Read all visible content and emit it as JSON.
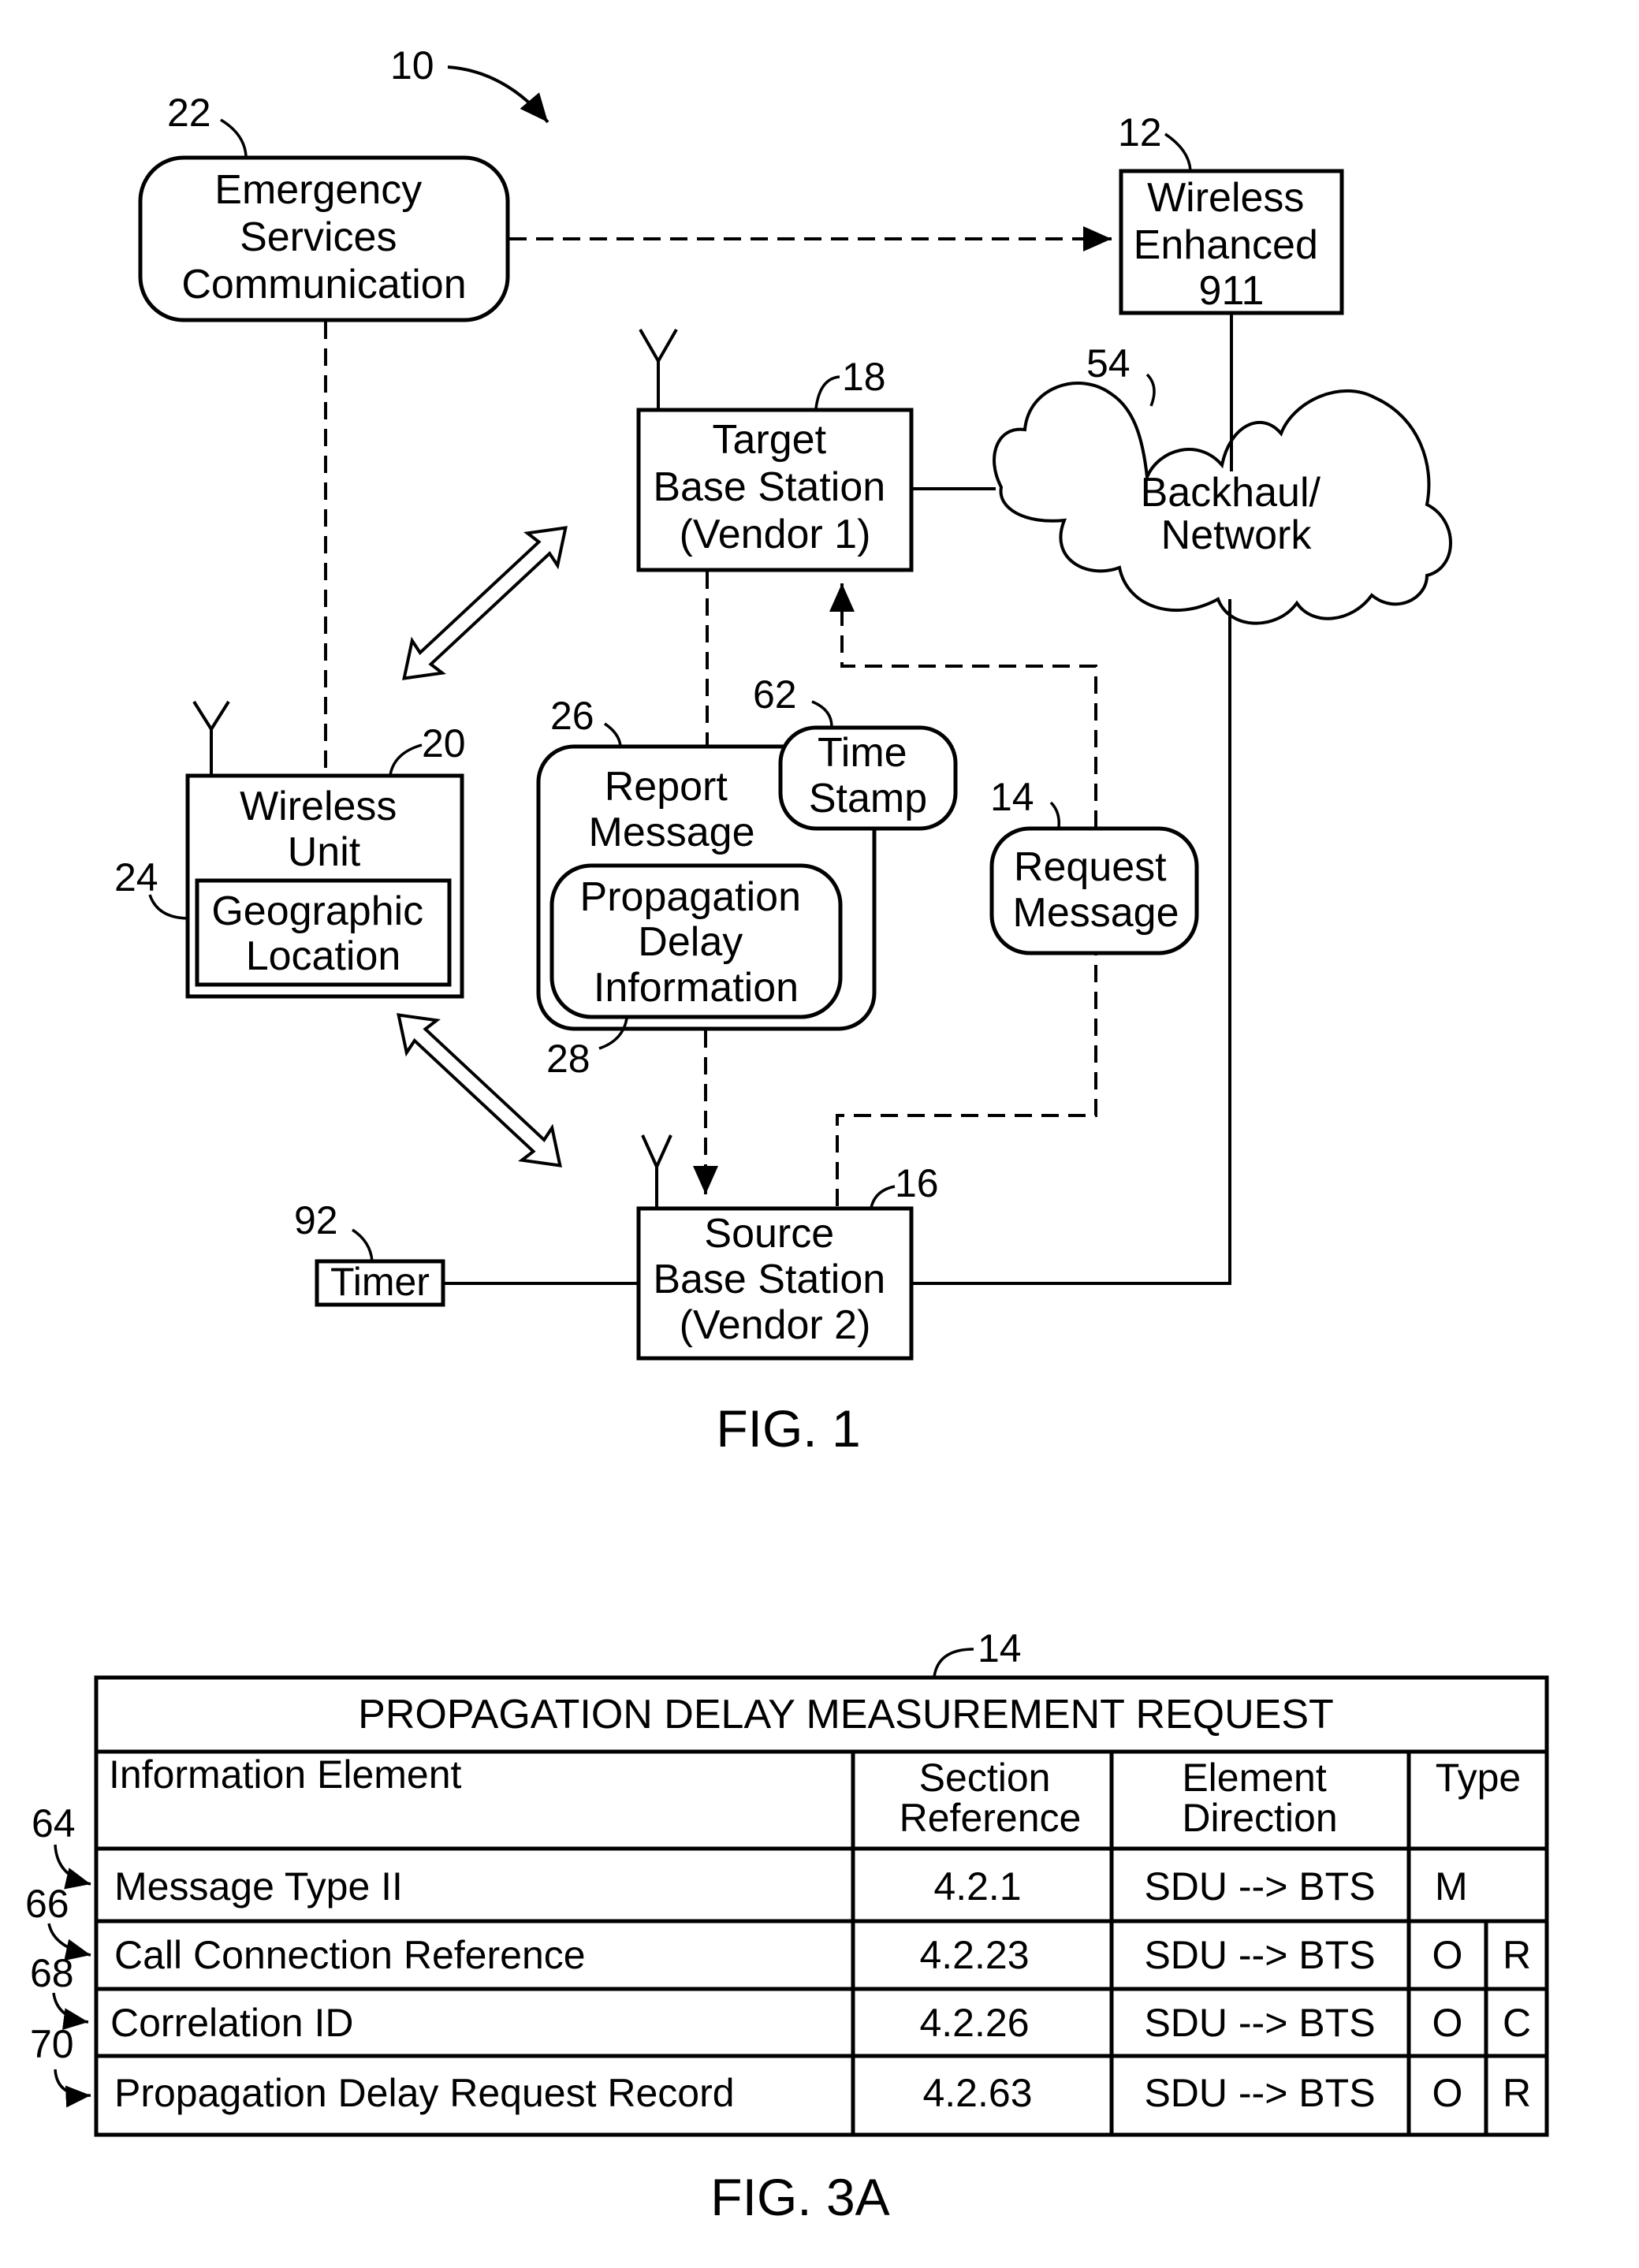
{
  "figure1": {
    "caption": "FIG. 1",
    "system_ref": "10",
    "nodes": {
      "emergency": {
        "ref": "22",
        "lines": [
          "Emergency",
          "Services",
          "Communication"
        ]
      },
      "e911": {
        "ref": "12",
        "lines": [
          "Wireless",
          "Enhanced",
          "911"
        ]
      },
      "target_bs": {
        "ref": "18",
        "lines": [
          "Target",
          "Base Station",
          "(Vendor 1)"
        ]
      },
      "network": {
        "ref": "54",
        "lines": [
          "Backhaul/",
          "Network"
        ]
      },
      "wireless_unit": {
        "ref": "20",
        "lines": [
          "Wireless",
          "Unit"
        ]
      },
      "geo_location": {
        "ref": "24",
        "lines": [
          "Geographic",
          "Location"
        ]
      },
      "report_message": {
        "ref": "26",
        "lines": [
          "Report",
          "Message"
        ]
      },
      "time_stamp": {
        "ref": "62",
        "lines": [
          "Time",
          "Stamp"
        ]
      },
      "prop_delay_info": {
        "ref": "28",
        "lines": [
          "Propagation",
          "Delay",
          "Information"
        ]
      },
      "request_message": {
        "ref": "14",
        "lines": [
          "Request",
          "Message"
        ]
      },
      "source_bs": {
        "ref": "16",
        "lines": [
          "Source",
          "Base Station",
          "(Vendor 2)"
        ]
      },
      "timer": {
        "ref": "92",
        "lines": [
          "Timer"
        ]
      }
    }
  },
  "figure3a": {
    "caption": "FIG. 3A",
    "table_ref": "14",
    "title": "PROPAGATION DELAY MEASUREMENT REQUEST",
    "headers": {
      "element": "Information Element",
      "section": [
        "Section",
        "Reference"
      ],
      "direction": [
        "Element",
        "Direction"
      ],
      "type": "Type"
    },
    "rows": [
      {
        "ref": "64",
        "element": "Message Type II",
        "section": "4.2.1",
        "direction": "SDU --> BTS",
        "type": "M",
        "subtype": ""
      },
      {
        "ref": "66",
        "element": "Call Connection Reference",
        "section": "4.2.23",
        "direction": "SDU --> BTS",
        "type": "O",
        "subtype": "R"
      },
      {
        "ref": "68",
        "element": "Correlation ID",
        "section": "4.2.26",
        "direction": "SDU --> BTS",
        "type": "O",
        "subtype": "C"
      },
      {
        "ref": "70",
        "element": "Propagation Delay Request Record",
        "section": "4.2.63",
        "direction": "SDU --> BTS",
        "type": "O",
        "subtype": "R"
      }
    ]
  }
}
